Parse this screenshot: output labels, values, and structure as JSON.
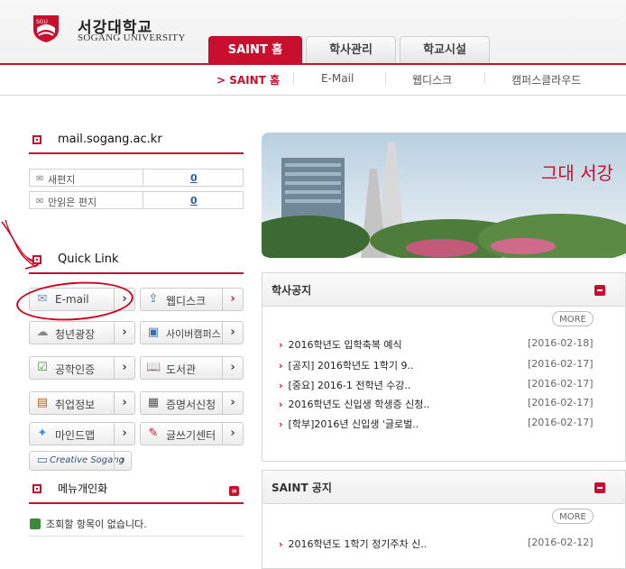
{
  "brand": {
    "name_kr": "서강대학교",
    "name_en": "SOGANG UNIVERSITY",
    "accent": "#c8102e"
  },
  "tabs": [
    {
      "label": "SAINT 홈",
      "active": true
    },
    {
      "label": "학사관리",
      "active": false
    },
    {
      "label": "학교시설",
      "active": false
    }
  ],
  "subnav": [
    {
      "label": "> SAINT 홈",
      "active": true
    },
    {
      "label": "E-Mail",
      "active": false
    },
    {
      "label": "웹디스크",
      "active": false
    },
    {
      "label": "캠퍼스클라우드",
      "active": false
    }
  ],
  "mail": {
    "title": "mail.sogang.ac.kr",
    "rows": [
      {
        "label": "새편지",
        "count": "0"
      },
      {
        "label": "안읽은 편지",
        "count": "0"
      }
    ]
  },
  "quick_link": {
    "title": "Quick Link",
    "items": [
      {
        "label": "E-mail",
        "icon": "envelope-icon"
      },
      {
        "label": "웹디스크",
        "icon": "upload-icon"
      },
      {
        "label": "청년광장",
        "icon": "chat-icon"
      },
      {
        "label": "사이버캠퍼스",
        "icon": "monitor-icon"
      },
      {
        "label": "공학인증",
        "icon": "certificate-icon"
      },
      {
        "label": "도서관",
        "icon": "book-icon"
      },
      {
        "label": "취업정보",
        "icon": "briefcase-icon"
      },
      {
        "label": "증명서신청",
        "icon": "document-icon"
      },
      {
        "label": "마인드맵",
        "icon": "mindmap-icon"
      },
      {
        "label": "글쓰기센터",
        "icon": "pencil-icon"
      },
      {
        "label": "Creative Sogang",
        "icon": "creative-icon"
      }
    ]
  },
  "menu_personalize": {
    "title": "메뉴개인화",
    "empty_message": "조회할 항목이 없습니다."
  },
  "banner": {
    "text": "그대 서강"
  },
  "academic_notice": {
    "title": "학사공지",
    "more": "MORE",
    "items": [
      {
        "title": "2016학년도 입학축복 예식",
        "date": "[2016-02-18]"
      },
      {
        "title": "[공지] 2016학년도 1학기 9..",
        "date": "[2016-02-17]"
      },
      {
        "title": "[중요] 2016-1 전학년 수강..",
        "date": "[2016-02-17]"
      },
      {
        "title": "2016학년도 신입생 학생증 신청..",
        "date": "[2016-02-17]"
      },
      {
        "title": "[학부]2016년 신입생 '글로벌..",
        "date": "[2016-02-17]"
      }
    ]
  },
  "saint_notice": {
    "title": "SAINT 공지",
    "more": "MORE",
    "items": [
      {
        "title": "2016학년도 1학기 정기주차 신..",
        "date": "[2016-02-12]"
      }
    ]
  }
}
